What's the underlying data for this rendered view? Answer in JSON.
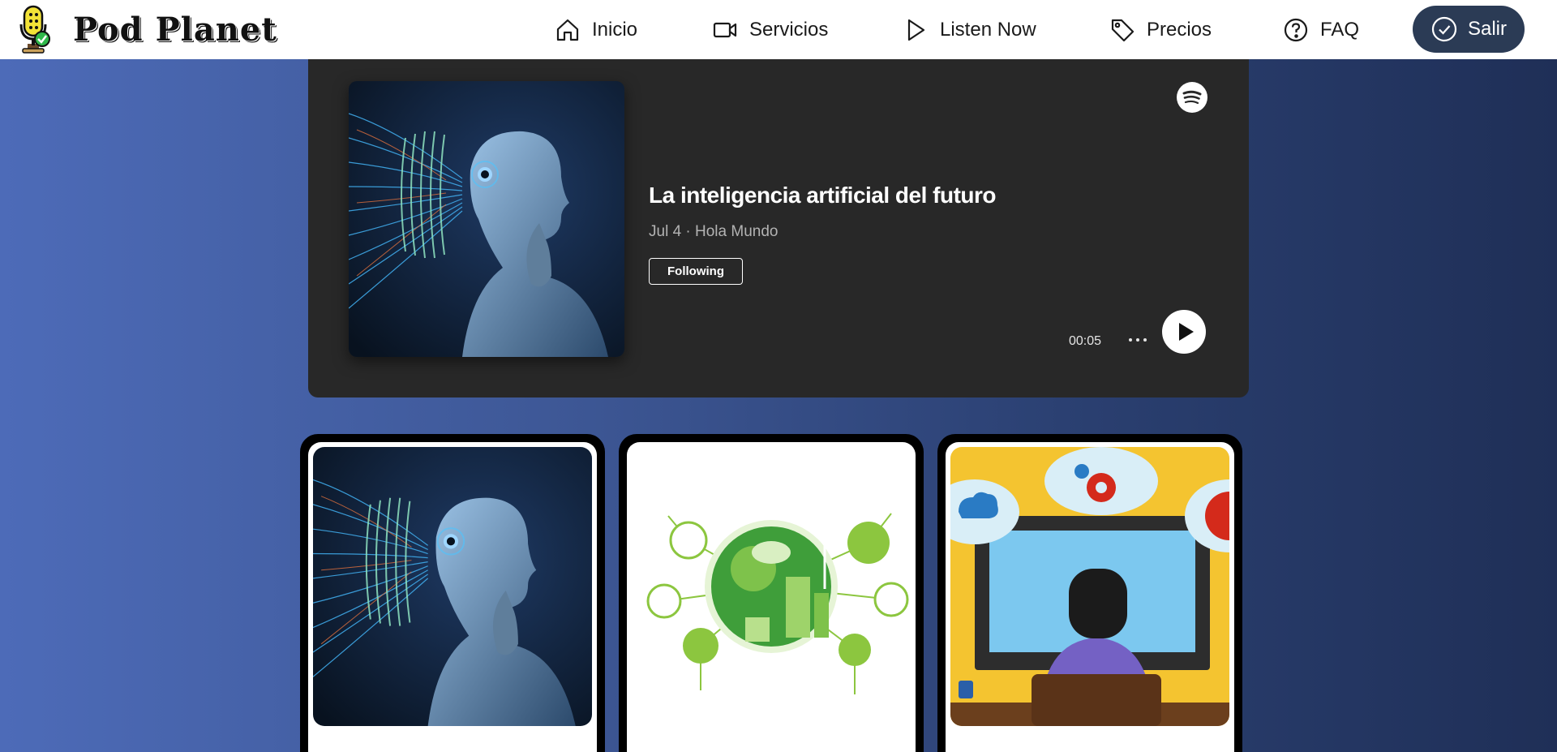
{
  "brand": {
    "name": "Pod Planet"
  },
  "nav": {
    "items": [
      {
        "label": "Inicio",
        "icon": "home-icon"
      },
      {
        "label": "Servicios",
        "icon": "video-camera-icon"
      },
      {
        "label": "Listen Now",
        "icon": "play-icon"
      },
      {
        "label": "Precios",
        "icon": "tag-icon"
      },
      {
        "label": "FAQ",
        "icon": "question-circle-icon"
      }
    ],
    "logout": {
      "label": "Salir",
      "icon": "check-circle-icon"
    }
  },
  "embed": {
    "title": "La inteligencia artificial del futuro",
    "meta": "Jul 4 · Hola Mundo",
    "follow_label": "Following",
    "time": "00:05",
    "provider_icon": "spotify-icon"
  },
  "cards": [
    {
      "image": "ai-robot-illustration"
    },
    {
      "image": "green-eco-city-illustration"
    },
    {
      "image": "person-at-computer-illustration"
    }
  ],
  "colors": {
    "nav_bg": "#ffffff",
    "logout_bg": "#2b3b55",
    "embed_bg": "#282828",
    "page_gradient_start": "#4d6bb8",
    "page_gradient_end": "#1f2f57"
  }
}
